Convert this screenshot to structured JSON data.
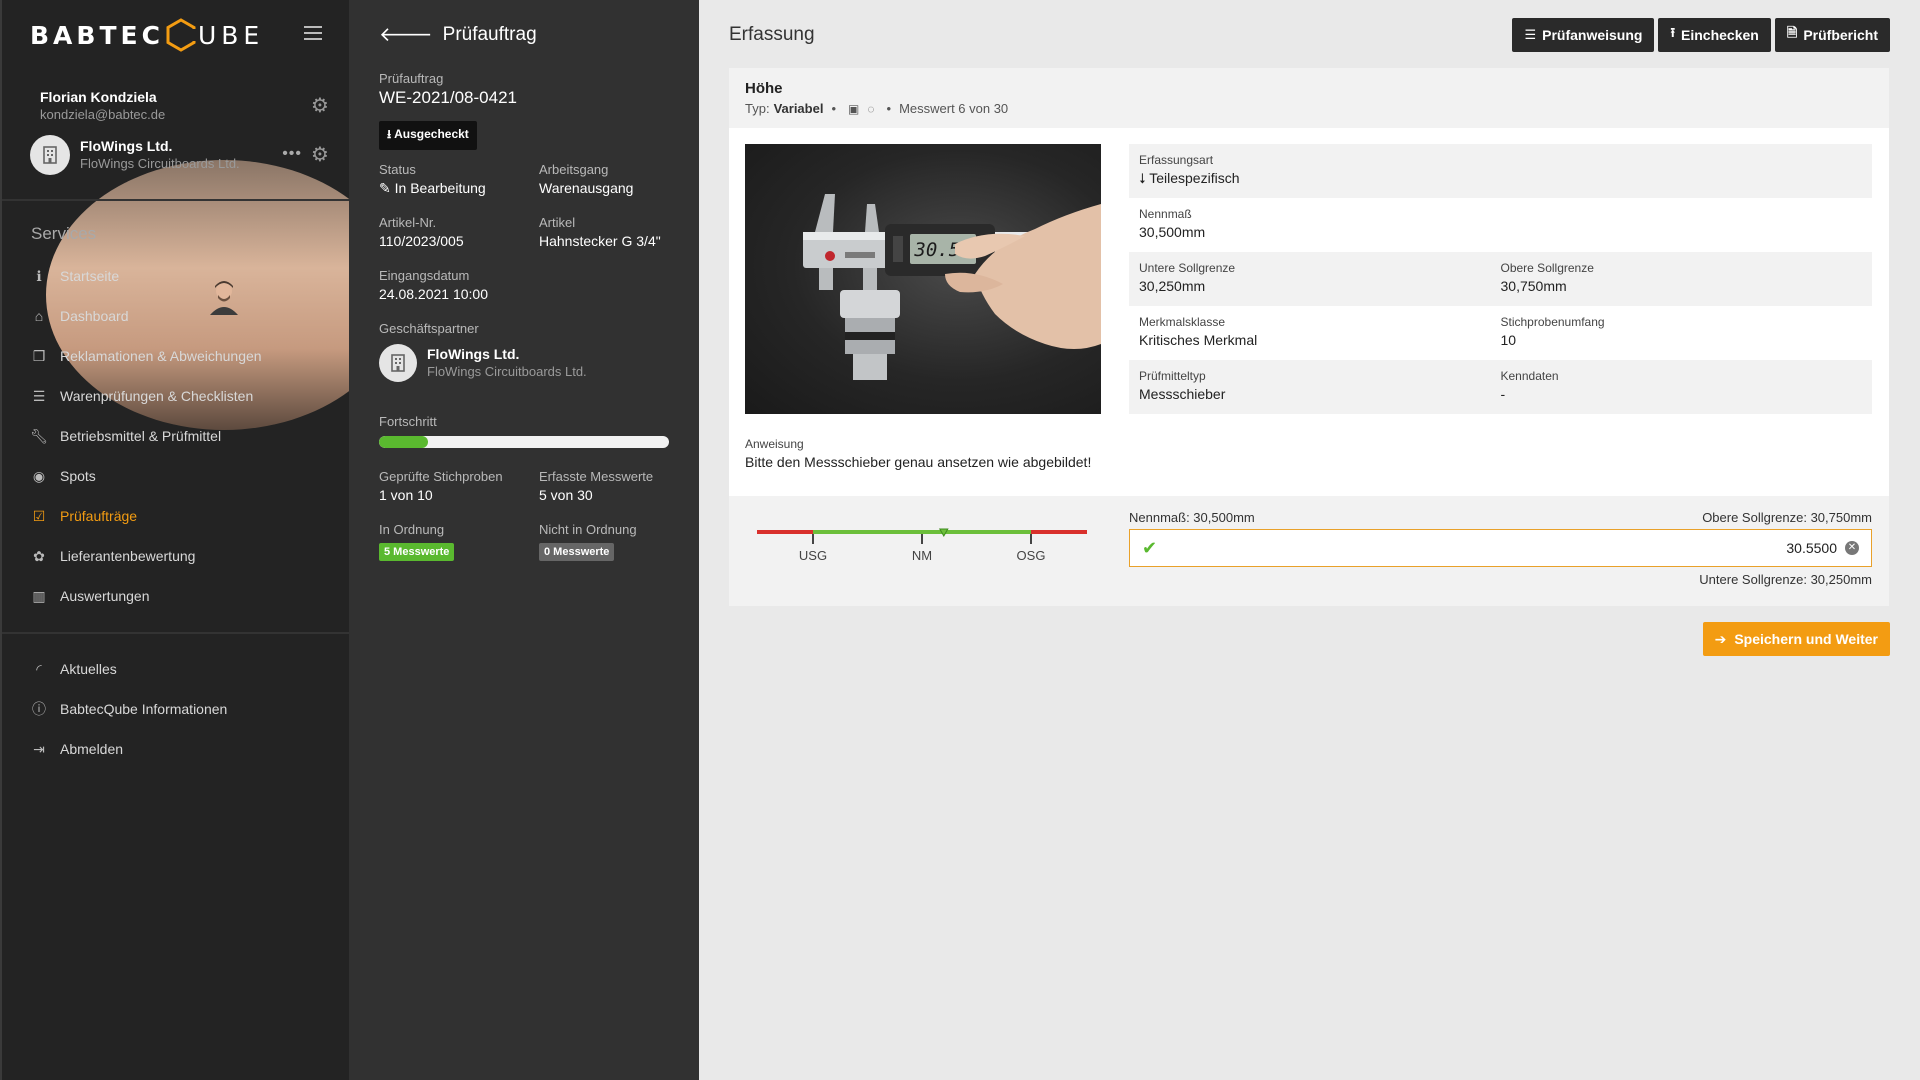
{
  "brand": {
    "left": "BABTEC",
    "right": "UBE"
  },
  "user": {
    "name": "Florian Kondziela",
    "email": "kondziela@babtec.de"
  },
  "company": {
    "name": "FloWings Ltd.",
    "sub": "FloWings Circuitboards Ltd."
  },
  "sidebar": {
    "services_label": "Services",
    "items": [
      {
        "label": "Startseite",
        "icon": "info-icon"
      },
      {
        "label": "Dashboard",
        "icon": "home-icon"
      },
      {
        "label": "Reklamationen & Abweichungen",
        "icon": "cubes-icon"
      },
      {
        "label": "Warenprüfungen & Checklisten",
        "icon": "list-icon"
      },
      {
        "label": "Betriebsmittel & Prüfmittel",
        "icon": "wrench-icon"
      },
      {
        "label": "Spots",
        "icon": "target-icon"
      },
      {
        "label": "Prüfaufträge",
        "icon": "checkbox-icon",
        "active": true
      },
      {
        "label": "Lieferantenbewertung",
        "icon": "palette-icon"
      },
      {
        "label": "Auswertungen",
        "icon": "bar-chart-icon"
      }
    ],
    "secondary": [
      {
        "label": "Aktuelles",
        "icon": "rss-icon"
      },
      {
        "label": "BabtecQube Informationen",
        "icon": "info-circle-icon"
      },
      {
        "label": "Abmelden",
        "icon": "sign-out-icon"
      }
    ]
  },
  "order": {
    "header": "Prüfauftrag",
    "id_label": "Prüfauftrag",
    "id": "WE-2021/08-0421",
    "checked_badge": "Ausgecheckt",
    "status_label": "Status",
    "status": "In Bearbeitung",
    "operation_label": "Arbeitsgang",
    "operation": "Warenausgang",
    "article_no_label": "Artikel-Nr.",
    "article_no": "110/2023/005",
    "article_label": "Artikel",
    "article": "Hahnstecker G 3/4\"",
    "date_label": "Eingangsdatum",
    "date": "24.08.2021 10:00",
    "partner_label": "Geschäftspartner",
    "partner_name": "FloWings Ltd.",
    "partner_sub": "FloWings Circuitboards Ltd.",
    "progress_label": "Fortschritt",
    "progress": 0.17,
    "samples_label": "Geprüfte Stichproben",
    "samples": "1 von 10",
    "values_label": "Erfasste Messwerte",
    "values": "5 von 30",
    "ok_label": "In Ordnung",
    "ok_value": "5 Messwerte",
    "nok_label": "Nicht in Ordnung",
    "nok_value": "0 Messwerte"
  },
  "main": {
    "title": "Erfassung",
    "buttons": [
      {
        "label": "Prüfanweisung",
        "icon": "list-icon"
      },
      {
        "label": "Einchecken",
        "icon": "upload-icon"
      },
      {
        "label": "Prüfbericht",
        "icon": "pdf-icon"
      }
    ]
  },
  "feature": {
    "title": "Höhe",
    "type_label": "Typ:",
    "type": "Variabel",
    "counter": "Messwert 6 von 30",
    "display_value": "30.50",
    "props": {
      "capture_label": "Erfassungsart",
      "capture": "Teilespezifisch",
      "nominal_label": "Nennmaß",
      "nominal": "30,500mm",
      "lower_label": "Untere Sollgrenze",
      "lower": "30,250mm",
      "upper_label": "Obere Sollgrenze",
      "upper": "30,750mm",
      "class_label": "Merkmalsklasse",
      "class": "Kritisches Merkmal",
      "sample_size_label": "Stichprobenumfang",
      "sample_size": "10",
      "tool_label": "Prüfmitteltyp",
      "tool": "Messschieber",
      "data_label": "Kenndaten",
      "data": "-"
    },
    "instruction_label": "Anweisung",
    "instruction": "Bitte den Messschieber genau ansetzen wie abgebildet!",
    "scale": {
      "usg": "USG",
      "nm": "NM",
      "osg": "OSG",
      "position": 0.6
    },
    "input_nominal": "Nennmaß: 30,500mm",
    "input_upper": "Obere Sollgrenze: 30,750mm",
    "input_lower": "Untere Sollgrenze: 30,250mm",
    "input_value": "30.5500"
  },
  "save_button": "Speichern und Weiter"
}
